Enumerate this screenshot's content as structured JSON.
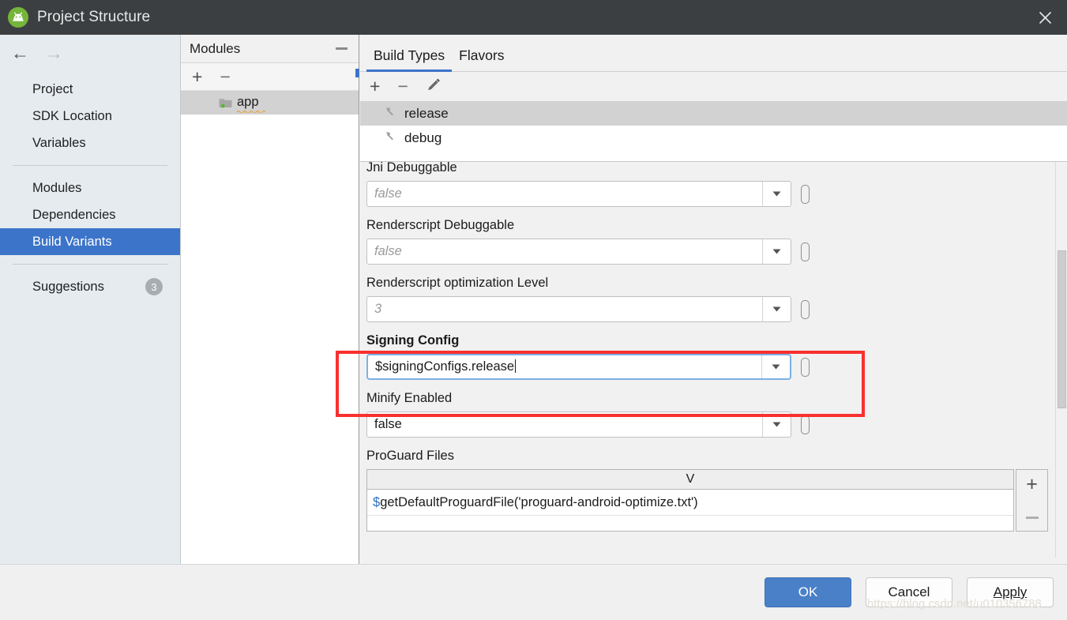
{
  "window": {
    "title": "Project Structure",
    "logo_icon": "android-studio-logo-icon",
    "close_icon": "close-icon"
  },
  "sidebar": {
    "back_icon": "arrow-left-icon",
    "forward_icon": "arrow-right-icon",
    "items": [
      {
        "label": "Project",
        "selected": false
      },
      {
        "label": "SDK Location",
        "selected": false
      },
      {
        "label": "Variables",
        "selected": false
      },
      {
        "label": "Modules",
        "selected": false
      },
      {
        "label": "Dependencies",
        "selected": false
      },
      {
        "label": "Build Variants",
        "selected": true
      },
      {
        "label": "Suggestions",
        "selected": false,
        "badge": "3"
      }
    ]
  },
  "modules_panel": {
    "title": "Modules",
    "minimize_icon": "minimize-icon",
    "add_label": "+",
    "remove_label": "−",
    "items": [
      {
        "label": "app",
        "icon": "folder-icon",
        "selected": true
      }
    ]
  },
  "main": {
    "tabs": [
      {
        "label": "Build Types",
        "active": true
      },
      {
        "label": "Flavors",
        "active": false
      }
    ],
    "toolbar": {
      "add_label": "+",
      "remove_label": "−",
      "edit_icon": "pencil-icon"
    },
    "build_types": [
      {
        "label": "release",
        "icon": "hammer-icon",
        "selected": true
      },
      {
        "label": "debug",
        "icon": "hammer-icon",
        "selected": false
      }
    ],
    "fields": [
      {
        "label": "Jni Debuggable",
        "value": "false",
        "is_placeholder": true,
        "bold": false,
        "focused": false,
        "var_button_icon": "variable-button-icon",
        "dropdown_icon": "chevron-down-icon"
      },
      {
        "label": "Renderscript Debuggable",
        "value": "false",
        "is_placeholder": true,
        "bold": false,
        "focused": false,
        "var_button_icon": "variable-button-icon",
        "dropdown_icon": "chevron-down-icon"
      },
      {
        "label": "Renderscript optimization Level",
        "value": "3",
        "is_placeholder": true,
        "bold": false,
        "focused": false,
        "var_button_icon": "variable-button-icon",
        "dropdown_icon": "chevron-down-icon"
      },
      {
        "label": "Signing Config",
        "value": "$signingConfigs.release",
        "is_placeholder": false,
        "bold": true,
        "focused": true,
        "var_button_icon": "variable-button-icon",
        "dropdown_icon": "chevron-down-icon"
      },
      {
        "label": "Minify Enabled",
        "value": "false",
        "is_placeholder": false,
        "bold": false,
        "focused": false,
        "var_button_icon": "variable-button-icon",
        "dropdown_icon": "chevron-down-icon"
      }
    ],
    "proguard": {
      "label": "ProGuard Files",
      "column_header": "V",
      "rows": [
        {
          "prefix": "$",
          "text": "getDefaultProguardFile('proguard-android-optimize.txt')"
        }
      ],
      "add_label": "+",
      "remove_label": "−"
    }
  },
  "footer": {
    "buttons": [
      {
        "label": "OK",
        "style": "primary",
        "mnemonic": ""
      },
      {
        "label": "Cancel",
        "style": "normal",
        "mnemonic": ""
      },
      {
        "label": "Apply",
        "style": "normal",
        "mnemonic": "A"
      }
    ]
  },
  "watermark": {
    "text": "https://blog.csdn.net/u010356788"
  },
  "colors": {
    "accent_blue": "#3c74c9",
    "annotation_red": "#f8312f",
    "titlebar": "#3c3f41",
    "sidebar": "#e6ebef",
    "logo_green": "#76b53b"
  }
}
